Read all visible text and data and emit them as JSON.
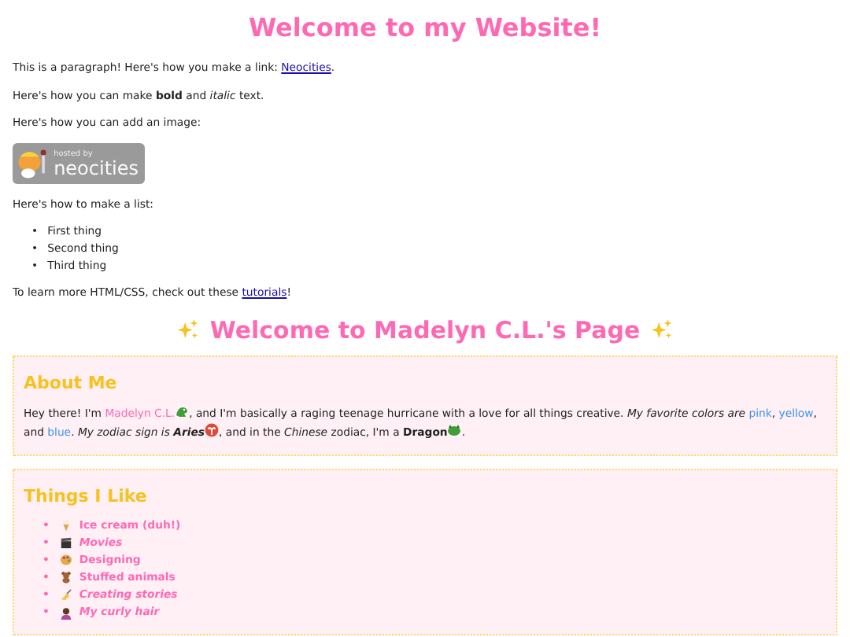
{
  "title": "Welcome to my Website!",
  "intro": [
    {
      "kind": "text",
      "text": "This is a paragraph! Here's how you make a link: ",
      "link": "Neocities",
      "after": "."
    },
    {
      "kind": "text",
      "text": "Here's how you can make **bold** and *italic* text."
    },
    {
      "kind": "text",
      "text": "Here's how you can add an image:"
    },
    {
      "kind": "badge",
      "small": "hosted by",
      "big": "neocities"
    },
    {
      "kind": "text",
      "text": "Here's how to make a list:"
    },
    {
      "kind": "list",
      "marker": "•",
      "items": [
        "First thing",
        "Second thing",
        "Third thing"
      ]
    },
    {
      "kind": "text",
      "text": "To learn more HTML/CSS, check out these ",
      "link": "tutorials",
      "after": "!"
    }
  ],
  "heading": "Welcome to Madelyn C.L.'s Page",
  "about": {
    "title": "About Me",
    "segments": [
      {
        "kind": "plain",
        "text": "Hey there! I'm "
      },
      {
        "kind": "name",
        "text": "Madelyn C.L."
      },
      {
        "kind": "icon"
      },
      {
        "kind": "plain",
        "text": ", and I'm basically a raging teenage hurricane with a love for all things creative. "
      },
      {
        "kind": "italic",
        "text": "My favorite colors are "
      },
      {
        "kind": "color-word",
        "text": "pink"
      },
      {
        "kind": "plain",
        "text": ", "
      },
      {
        "kind": "color-word",
        "text": "yellow"
      },
      {
        "kind": "plain",
        "text": ", and "
      },
      {
        "kind": "color-word",
        "text": "blue"
      },
      {
        "kind": "plain",
        "text": ". "
      },
      {
        "kind": "italic",
        "text": "My zodiac sign is "
      },
      {
        "kind": "bold-italic",
        "text": "Aries"
      },
      {
        "kind": "icon"
      },
      {
        "kind": "plain",
        "text": ", and in the "
      },
      {
        "kind": "italic",
        "text": "Chinese"
      },
      {
        "kind": "plain",
        "text": " zodiac, I'm a "
      },
      {
        "kind": "bold",
        "text": "Dragon"
      },
      {
        "kind": "icon"
      },
      {
        "kind": "plain",
        "text": "."
      }
    ]
  },
  "likes": {
    "title": "Things I Like",
    "marker": "•",
    "items": [
      {
        "text": "Ice cream (duh!)",
        "italic": false
      },
      {
        "text": "Movies",
        "italic": true
      },
      {
        "text": "Designing",
        "italic": false
      },
      {
        "text": "Stuffed animals",
        "italic": false
      },
      {
        "text": "Creating stories",
        "italic": true
      },
      {
        "text": "My curly hair",
        "italic": true
      }
    ]
  }
}
